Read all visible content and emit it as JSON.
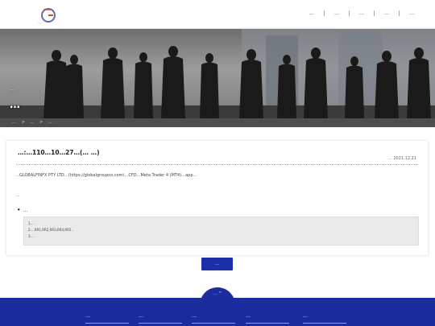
{
  "header": {
    "logo_text": "…",
    "nav": [
      "…",
      "…",
      "…",
      "…",
      "…"
    ]
  },
  "hero": {
    "subtitle": "…",
    "title": "…"
  },
  "breadcrumb": [
    "…",
    ">",
    "…",
    ">",
    "…"
  ],
  "article": {
    "title": "…:…110…10…27…(… …)",
    "date": "… 2021.12.21",
    "paragraph1": "…GLOBALFINFX PTY LTD…(https://globalgroupco.com)…CFD…Meta Trader 4 (MT4)…app…",
    "paragraph2": "…",
    "refs_heading": "…",
    "refs": [
      "1.…",
      "2.…RR1,RR2,RR3,RR4,RR5…",
      "3.…"
    ]
  },
  "back_button": "…",
  "footer": {
    "tab_label": "… ^",
    "columns": [
      "…",
      "…",
      "…",
      "…",
      "…"
    ]
  },
  "colors": {
    "brand_blue": "#1b2c9e",
    "breadcrumb_bg": "#4d4d4d"
  }
}
